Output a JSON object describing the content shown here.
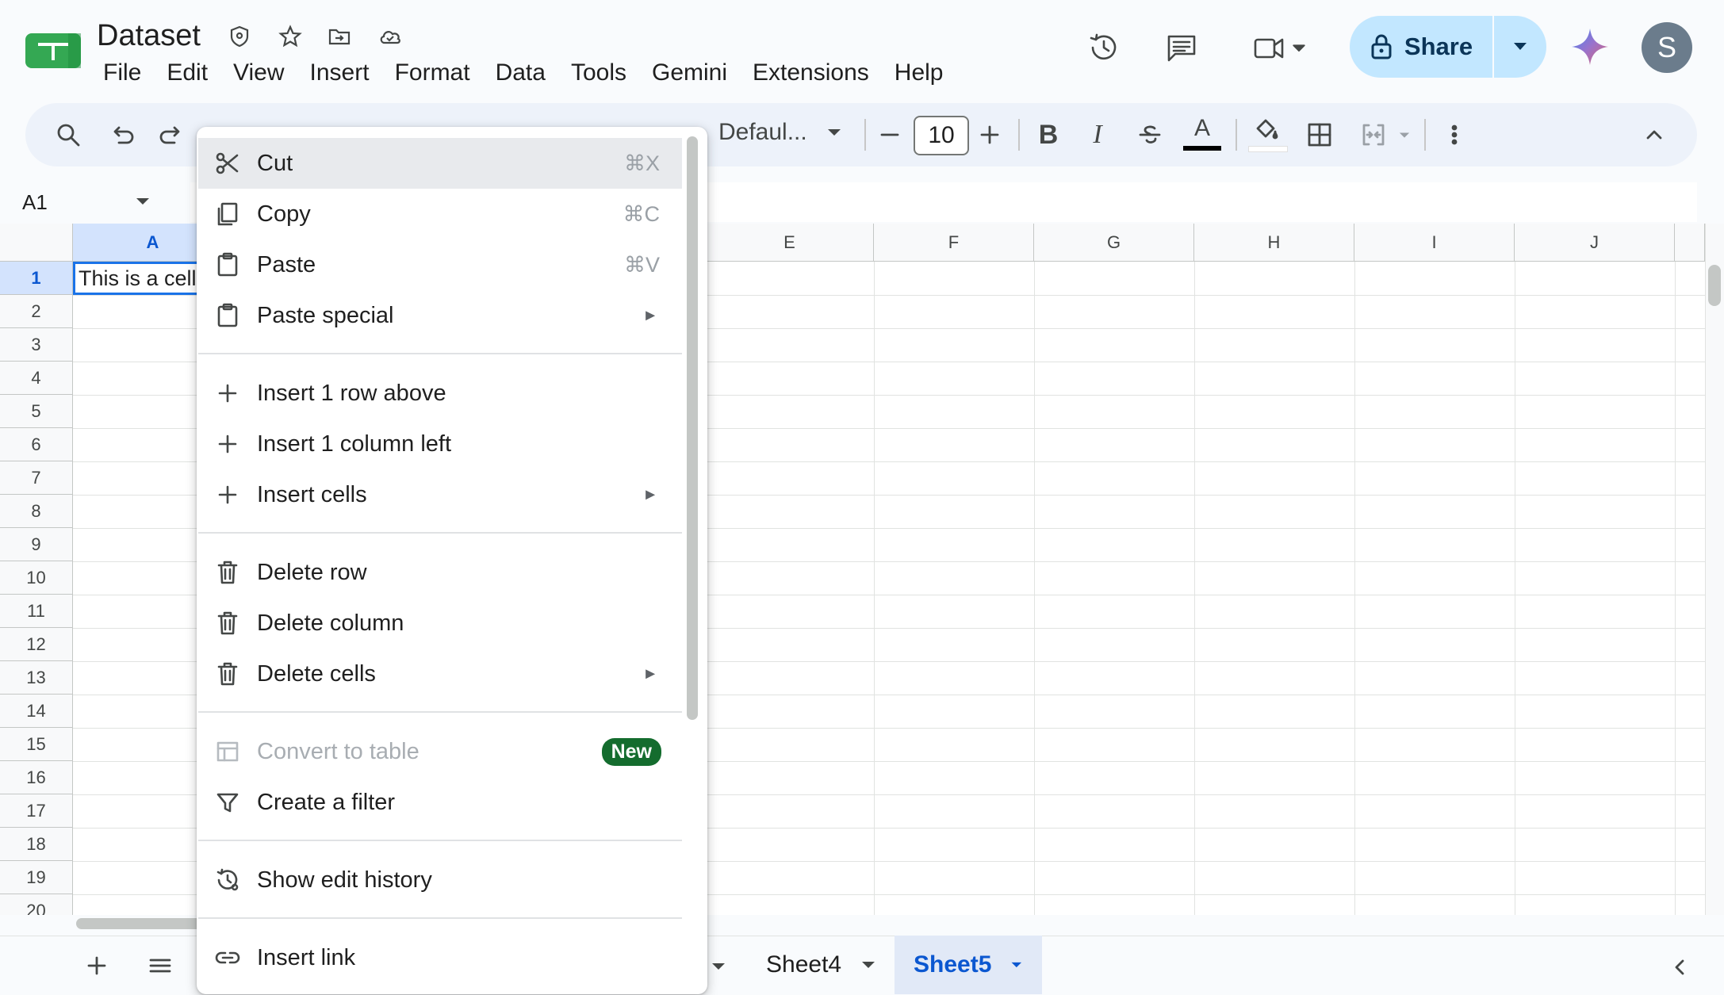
{
  "header": {
    "title": "Dataset",
    "menus": [
      "File",
      "Edit",
      "View",
      "Insert",
      "Format",
      "Data",
      "Tools",
      "Gemini",
      "Extensions",
      "Help"
    ],
    "share_label": "Share",
    "avatar_initial": "S"
  },
  "toolbar": {
    "font_name": "Defaul...",
    "font_size": "10",
    "bold": "B",
    "italic": "I",
    "underline_color": "A"
  },
  "formula_bar": {
    "name_box": "A1"
  },
  "grid": {
    "columns": [
      "A",
      "E",
      "F",
      "G",
      "H",
      "I",
      "J"
    ],
    "rows": [
      "1",
      "2",
      "3",
      "4",
      "5",
      "6",
      "7",
      "8",
      "9",
      "10",
      "11",
      "12",
      "13",
      "14",
      "15",
      "16",
      "17",
      "18",
      "19",
      "20"
    ],
    "cell_a1": "This is a cell"
  },
  "context_menu": {
    "items": [
      {
        "label": "Cut",
        "shortcut": "⌘X",
        "icon": "scissors-icon"
      },
      {
        "label": "Copy",
        "shortcut": "⌘C",
        "icon": "copy-icon"
      },
      {
        "label": "Paste",
        "shortcut": "⌘V",
        "icon": "clipboard-icon"
      },
      {
        "label": "Paste special",
        "icon": "clipboard-icon",
        "submenu": true
      },
      {
        "label": "Insert 1 row above",
        "icon": "plus-icon"
      },
      {
        "label": "Insert 1 column left",
        "icon": "plus-icon"
      },
      {
        "label": "Insert cells",
        "icon": "plus-icon",
        "submenu": true
      },
      {
        "label": "Delete row",
        "icon": "trash-icon"
      },
      {
        "label": "Delete column",
        "icon": "trash-icon"
      },
      {
        "label": "Delete cells",
        "icon": "trash-icon",
        "submenu": true
      },
      {
        "label": "Convert to table",
        "icon": "table-icon",
        "badge": "New",
        "disabled": true
      },
      {
        "label": "Create a filter",
        "icon": "filter-icon"
      },
      {
        "label": "Show edit history",
        "icon": "history-icon"
      },
      {
        "label": "Insert link",
        "icon": "link-icon"
      }
    ],
    "submenu_arrow": "►"
  },
  "sheets": {
    "tabs": [
      "Sheet4",
      "Sheet5"
    ],
    "active": "Sheet5"
  },
  "colors": {
    "accent": "#0b57d0",
    "share_bg": "#c2e7ff",
    "new_badge": "#146c2e",
    "selection": "#1a73e8"
  }
}
